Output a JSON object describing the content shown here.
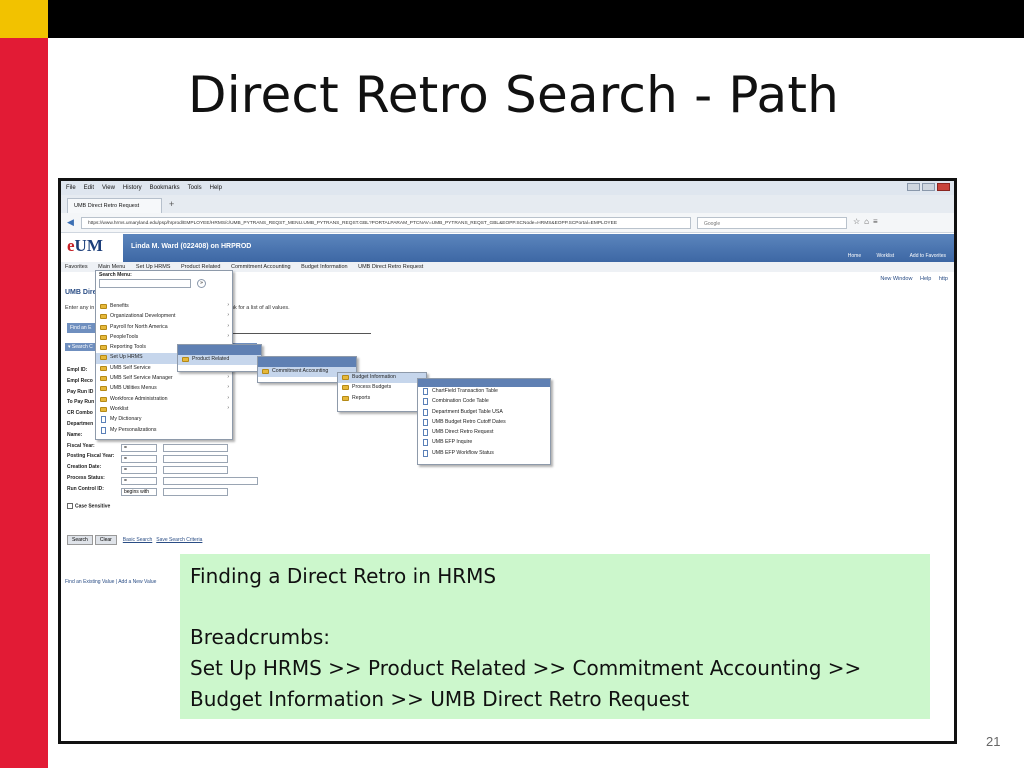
{
  "slide": {
    "title": "Direct Retro Search - Path",
    "page_number": "21",
    "accent_red": "#e21b35",
    "accent_yellow": "#f2c200"
  },
  "browser": {
    "menu": [
      "File",
      "Edit",
      "View",
      "History",
      "Bookmarks",
      "Tools",
      "Help"
    ],
    "tab_title": "UMB Direct Retro Request",
    "url": "https://www.hrms.umaryland.edu/psp/hrprod/EMPLOYEE/HRMS/c/UMB_PYTRANS_REQST_MENU.UMB_PYTRANS_REQST.GBL?PORTALPARAM_PTCNAV=UMB_PYTRANS_REQST_GBL&EOPP.SCNode=HRMS&EOPP.SCPortal=EMPLOYEE",
    "search_placeholder": "Google"
  },
  "app": {
    "logo_e": "e",
    "logo_um": "UM",
    "user": "Linda M. Ward (022408) on HRPROD",
    "header_links": [
      "Home",
      "Worklist",
      "Add to Favorites"
    ],
    "breadcrumbs": [
      "Favorites",
      "Main Menu",
      "Set Up HRMS",
      "Product Related",
      "Commitment Accounting",
      "Budget Information",
      "UMB Direct Retro Request"
    ],
    "page_title": "UMB Dire",
    "intro_start": "Enter any in",
    "intro_end": "nk for a list of all values.",
    "right_links": [
      "New Window",
      "Help",
      "http"
    ],
    "find_tab": "Find an E",
    "search_criteria": "▾ Search C",
    "field_labels": [
      "Empl ID:",
      "Empl Reco",
      "Pay Run ID",
      "To Pay Run",
      "CR Combo",
      "Departmen",
      "Name:",
      "Fiscal Year:",
      "Posting Fiscal Year:",
      "Creation Date:",
      "Process Status:",
      "Run Control ID:"
    ],
    "field_ops": [
      "=",
      "=",
      "=",
      "=",
      "begins with"
    ],
    "case_sensitive": "Case Sensitive",
    "buttons": {
      "search": "Search",
      "clear": "Clear",
      "basic": "Basic Search",
      "save": "Save Search Criteria"
    },
    "find_links": [
      "Find an Existing Value",
      "Add a New Value"
    ]
  },
  "menus": {
    "search_menu_label": "Search Menu:",
    "level1": [
      "Benefits",
      "Organizational Development",
      "Payroll for North America",
      "PeopleTools",
      "Reporting Tools",
      "Set Up HRMS",
      "UMB Self Service",
      "UMB Self Service Manager",
      "UMB Utilities Menus",
      "Workforce Administration",
      "Worklist",
      "My Dictionary",
      "My Personalizations"
    ],
    "level2": [
      "Product Related"
    ],
    "level3": [
      "Commitment Accounting"
    ],
    "level4": [
      "Budget Information",
      "Process Budgets",
      "Reports"
    ],
    "level5": [
      "ChartField Transaction Table",
      "Combination Code Table",
      "Department Budget Table USA",
      "UMB Budget Retro Cutoff Dates",
      "UMB Direct Retro Request",
      "UMB EFP Inquire",
      "UMB EFP Workflow Status"
    ]
  },
  "note": {
    "title": "Finding a Direct Retro in HRMS",
    "label": "Breadcrumbs:",
    "line1": "Set Up HRMS >> Product Related >> Commitment Accounting >>",
    "line2": "Budget Information >> UMB Direct Retro Request",
    "bg_color": "#ccf7cc"
  }
}
